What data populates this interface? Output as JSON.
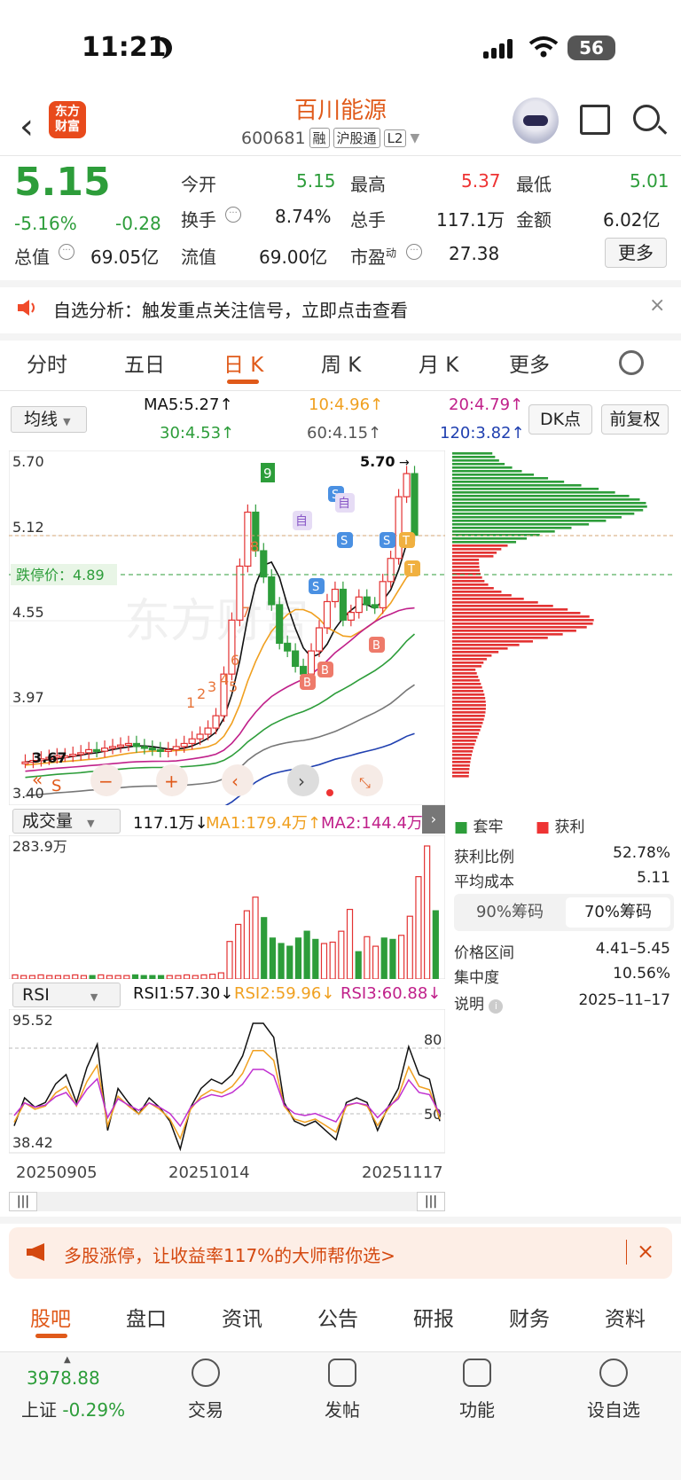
{
  "status_bar": {
    "time": "11:21",
    "battery": "56"
  },
  "header": {
    "stock_name": "百川能源",
    "stock_code": "600681",
    "tags": [
      "融",
      "沪股通",
      "L2"
    ],
    "logo_text": "东方\n财富"
  },
  "quote": {
    "price": "5.15",
    "change_pct": "-5.16%",
    "change": "-0.28",
    "open_label": "今开",
    "open": "5.15",
    "high_label": "最高",
    "high": "5.37",
    "low_label": "最低",
    "low": "5.01",
    "turnover_label": "换手",
    "turnover": "8.74%",
    "volume_label": "总手",
    "volume": "117.1万",
    "amount_label": "金额",
    "amount": "6.02亿",
    "mktcap_label": "总值",
    "mktcap": "69.05亿",
    "float_label": "流值",
    "float_cap": "69.00亿",
    "pe_label": "市盈",
    "pe_sup": "动",
    "pe": "27.38",
    "more_button": "更多"
  },
  "notice": {
    "text": "自选分析：触发重点关注信号，立即点击查看",
    "close": "×"
  },
  "period_tabs": [
    "分时",
    "五日",
    "日 K",
    "周 K",
    "月 K",
    "更多"
  ],
  "period_active": "日 K",
  "ma_bar": {
    "select": "均线",
    "ma5": "MA5:5.27↑",
    "ma10": "10:4.96↑",
    "ma20": "20:4.79↑",
    "ma30": "30:4.53↑",
    "ma60": "60:4.15↑",
    "ma120": "120:3.82↑",
    "dk_button": "DK点",
    "adjust_button": "前复权"
  },
  "colors": {
    "up": "#e33333",
    "down": "#2d9d3a",
    "ma5": "#111111",
    "ma10": "#f0a020",
    "ma20": "#c0208a",
    "ma30": "#2d9d3a",
    "ma60": "#777777",
    "ma120": "#2040b0",
    "accent": "#e05a1a"
  },
  "kline": {
    "y_top": "5.70",
    "y_512": "5.12",
    "y_455": "4.55",
    "y_397": "3.97",
    "y_bottom": "3.40",
    "high_marker": "5.70",
    "low_marker": "3.67",
    "limit_down_label": "跌停价：4.89",
    "watermark": "东方财富",
    "badges_nine": "9",
    "seq_numbers": [
      "1",
      "2",
      "3",
      "4",
      "5",
      "6",
      "7",
      "8"
    ],
    "signal_S": "S",
    "signal_B": "B",
    "signal_T": "T",
    "signal_zi": "自",
    "chart_data": {
      "type": "candlestick",
      "ylim": [
        3.4,
        5.7
      ],
      "last_close": 5.15
    }
  },
  "volume": {
    "select": "成交量",
    "vol": "117.1万↓",
    "ma1": "MA1:179.4万↑",
    "ma2": "MA2:144.4万",
    "top_value": "283.9万"
  },
  "rsi": {
    "select": "RSI",
    "rsi1": "RSI1:57.30↓",
    "rsi2": "RSI2:59.96↓",
    "rsi3": "RSI3:60.88↓",
    "y_top": "95.52",
    "y_bottom": "38.42",
    "line80": "80",
    "line50": "50",
    "dates": [
      "20250905",
      "20251014",
      "20251117"
    ]
  },
  "chips": {
    "legend_trapped": "套牢",
    "legend_profit": "获利",
    "profit_ratio_label": "获利比例",
    "profit_ratio": "52.78%",
    "avg_cost_label": "平均成本",
    "avg_cost": "5.11",
    "opt90": "90%筹码",
    "opt70": "70%筹码",
    "range_label": "价格区间",
    "range": "4.41–5.45",
    "concentration_label": "集中度",
    "concentration": "10.56%",
    "note_label": "说明",
    "note_date": "2025–11–17"
  },
  "promo": {
    "text": "多股涨停，让收益率117%的大师帮你选>",
    "close": "×"
  },
  "bottom_tabs": [
    "股吧",
    "盘口",
    "资讯",
    "公告",
    "研报",
    "财务",
    "资料"
  ],
  "bottom_nav": {
    "index_value": "3978.88",
    "index_name": "上证",
    "index_pct": "-0.29%",
    "items": [
      "交易",
      "发帖",
      "功能",
      "设自选"
    ]
  }
}
